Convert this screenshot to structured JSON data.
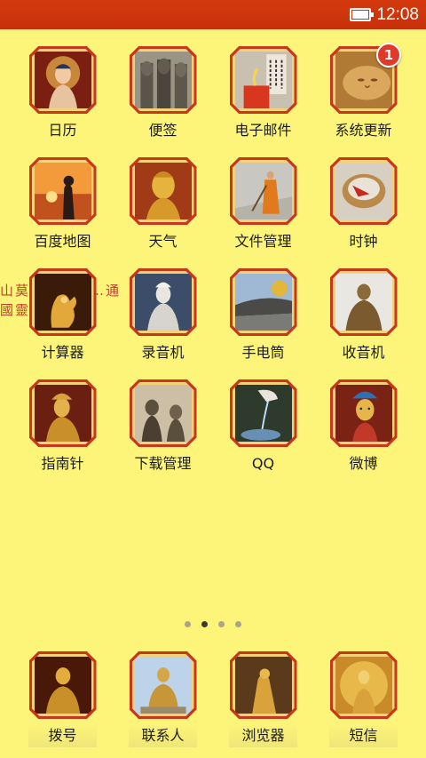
{
  "status_bar": {
    "time": "12:08",
    "battery_icon": "battery-icon"
  },
  "calligraphy": {
    "line1": "山莫只…山只…通",
    "line2": "國靈…向靈"
  },
  "apps": [
    {
      "label": "日历",
      "icon": "buddha-calendar-icon",
      "scene": "buddha"
    },
    {
      "label": "便签",
      "icon": "statues-notes-icon",
      "scene": "statues"
    },
    {
      "label": "电子邮件",
      "icon": "calligraphy-email-icon",
      "scene": "scroll"
    },
    {
      "label": "系统更新",
      "icon": "reclining-buddha-update-icon",
      "scene": "reclining",
      "badge": "1"
    },
    {
      "label": "百度地图",
      "icon": "sunset-buddha-map-icon",
      "scene": "sunset"
    },
    {
      "label": "天气",
      "icon": "golden-buddha-weather-icon",
      "scene": "golden"
    },
    {
      "label": "文件管理",
      "icon": "monk-sweeping-files-icon",
      "scene": "monk"
    },
    {
      "label": "时钟",
      "icon": "basket-clock-icon",
      "scene": "basket"
    },
    {
      "label": "计算器",
      "icon": "golden-hand-calculator-icon",
      "scene": "hand"
    },
    {
      "label": "录音机",
      "icon": "guanyin-recorder-icon",
      "scene": "guanyin"
    },
    {
      "label": "手电筒",
      "icon": "temple-roof-flashlight-icon",
      "scene": "temple"
    },
    {
      "label": "收音机",
      "icon": "bronze-buddha-radio-icon",
      "scene": "bronze"
    },
    {
      "label": "指南针",
      "icon": "golden-deity-compass-icon",
      "scene": "deity"
    },
    {
      "label": "下载管理",
      "icon": "buddha-row-download-icon",
      "scene": "row"
    },
    {
      "label": "QQ",
      "icon": "water-pouring-qq-icon",
      "scene": "water"
    },
    {
      "label": "微博",
      "icon": "tara-weibo-icon",
      "scene": "tara"
    }
  ],
  "page_indicator": {
    "count": 4,
    "active_index": 1
  },
  "dock": [
    {
      "label": "拨号",
      "icon": "golden-buddha-dialer-icon",
      "scene": "dial"
    },
    {
      "label": "联系人",
      "icon": "great-buddha-contacts-icon",
      "scene": "great"
    },
    {
      "label": "浏览器",
      "icon": "golden-statue-browser-icon",
      "scene": "statue"
    },
    {
      "label": "短信",
      "icon": "thousand-arm-messaging-icon",
      "scene": "thousand"
    }
  ],
  "colors": {
    "status_bar": "#c7300a",
    "background": "#fdf47a",
    "frame": "#c7371a",
    "frame_inner": "#f3d27a",
    "badge": "#e03a2a"
  }
}
